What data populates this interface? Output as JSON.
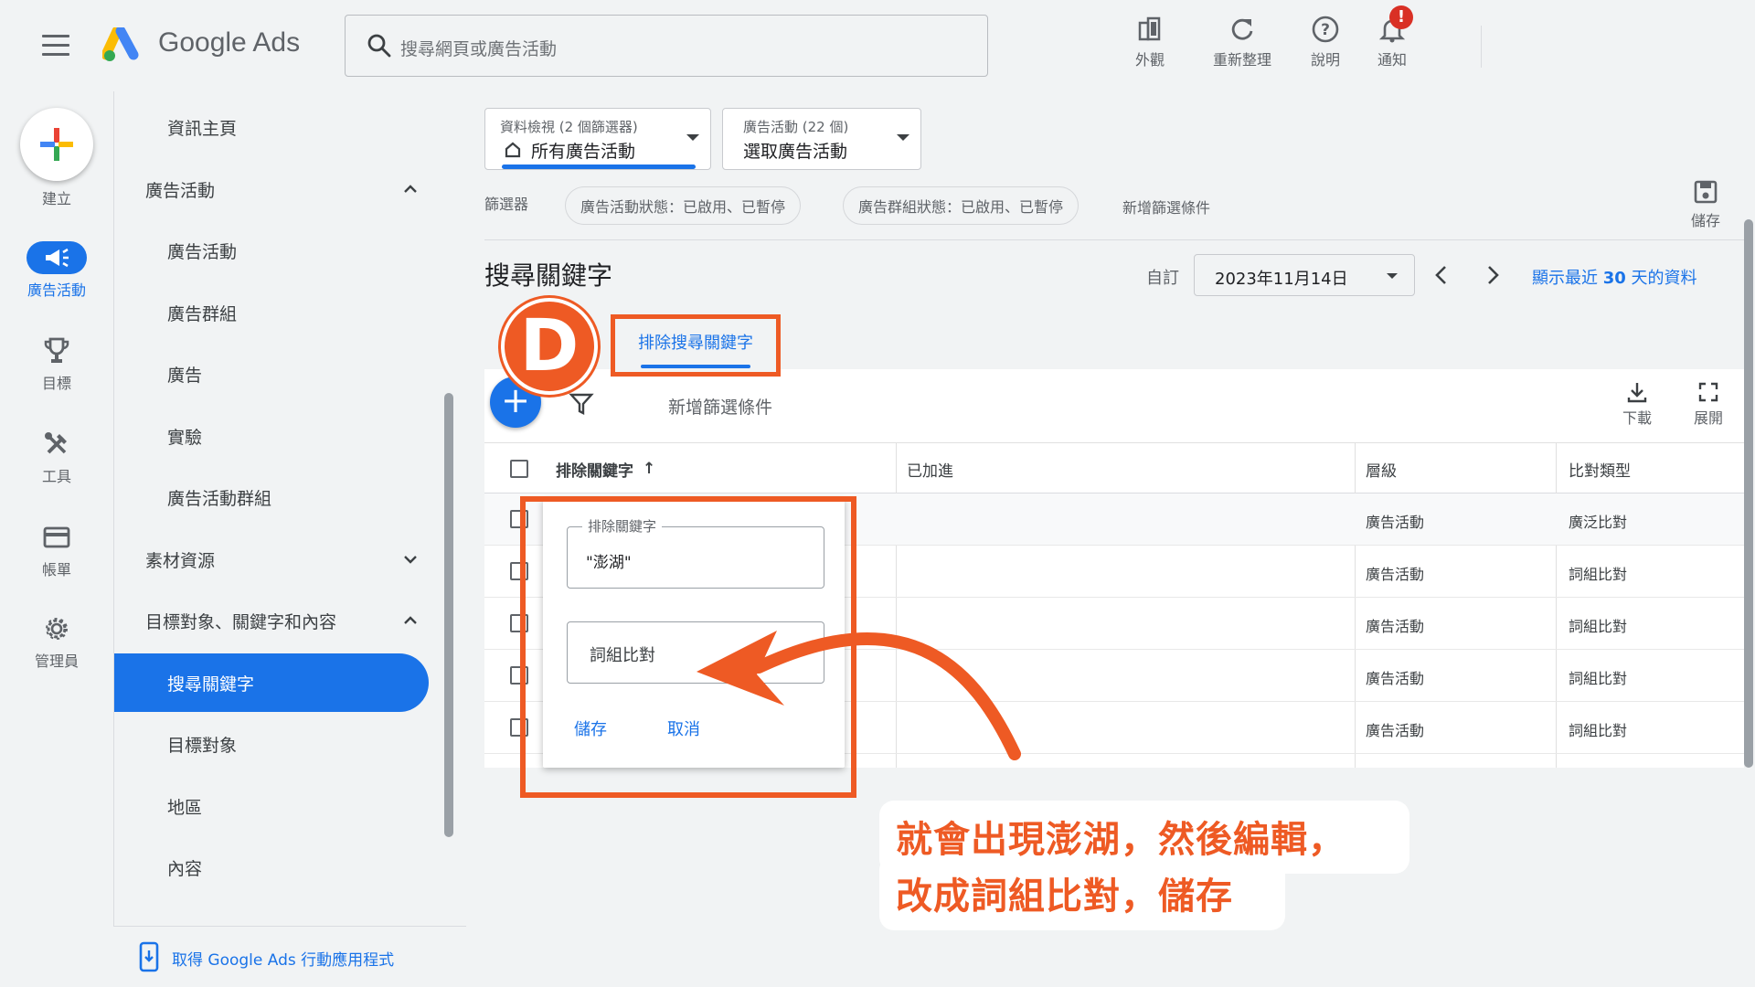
{
  "header": {
    "product_name": "Google Ads",
    "search_placeholder": "搜尋網頁或廣告活動",
    "actions": [
      {
        "label": "外觀",
        "icon": "appearance-icon"
      },
      {
        "label": "重新整理",
        "icon": "refresh-icon"
      },
      {
        "label": "說明",
        "icon": "help-icon"
      },
      {
        "label": "通知",
        "icon": "bell-icon"
      }
    ],
    "notification_badge": "!"
  },
  "rail": {
    "create_label": "建立",
    "items": [
      {
        "label": "廣告活動",
        "icon": "megaphone-icon",
        "active": true
      },
      {
        "label": "目標",
        "icon": "trophy-icon",
        "active": false
      },
      {
        "label": "工具",
        "icon": "tools-icon",
        "active": false
      },
      {
        "label": "帳單",
        "icon": "credit-card-icon",
        "active": false
      },
      {
        "label": "管理員",
        "icon": "gear-icon",
        "active": false
      }
    ]
  },
  "nav": {
    "items": [
      {
        "label": "資訊主頁",
        "type": "sub"
      },
      {
        "label": "廣告活動",
        "type": "section",
        "expanded": true
      },
      {
        "label": "廣告活動",
        "type": "sub"
      },
      {
        "label": "廣告群組",
        "type": "sub"
      },
      {
        "label": "廣告",
        "type": "sub"
      },
      {
        "label": "實驗",
        "type": "sub"
      },
      {
        "label": "廣告活動群組",
        "type": "sub"
      },
      {
        "label": "素材資源",
        "type": "section",
        "expanded": false
      },
      {
        "label": "目標對象、關鍵字和內容",
        "type": "section",
        "expanded": true
      },
      {
        "label": "搜尋關鍵字",
        "type": "sub",
        "active": true
      },
      {
        "label": "目標對象",
        "type": "sub"
      },
      {
        "label": "地區",
        "type": "sub"
      },
      {
        "label": "內容",
        "type": "sub"
      }
    ],
    "footer_link": "取得 Google Ads 行動應用程式"
  },
  "filters": {
    "view_small": "資料檢視 (2 個篩選器)",
    "view_big": "所有廣告活動",
    "campaign_small": "廣告活動 (22 個)",
    "campaign_big": "選取廣告活動",
    "label": "篩選器",
    "chips": [
      "廣告活動狀態：已啟用、已暫停",
      "廣告群組狀態：已啟用、已暫停"
    ],
    "add_filter": "新增篩選條件",
    "save_label": "儲存"
  },
  "page": {
    "title": "搜尋關鍵字",
    "date_label": "自訂",
    "date_value": "2023年11月14日",
    "recent_link_prefix": "顯示最近 ",
    "recent_link_num": "30",
    "recent_link_suffix": " 天的資料"
  },
  "tab": {
    "label": "排除搜尋關鍵字",
    "badge": "D"
  },
  "toolbar": {
    "add_filter": "新增篩選條件",
    "download": "下載",
    "expand": "展開"
  },
  "table": {
    "headers": [
      "排除關鍵字",
      "已加進",
      "層級",
      "比對類型"
    ],
    "sort_arrow": "↑",
    "rows": [
      {
        "level": "廣告活動",
        "match": "廣泛比對"
      },
      {
        "level": "廣告活動",
        "match": "詞組比對"
      },
      {
        "level": "廣告活動",
        "match": "詞組比對"
      },
      {
        "level": "廣告活動",
        "match": "詞組比對"
      },
      {
        "level": "廣告活動",
        "match": "詞組比對"
      }
    ]
  },
  "popover": {
    "field_label": "排除關鍵字",
    "field_value": "\"澎湖\"",
    "match_value": "詞組比對",
    "save": "儲存",
    "cancel": "取消"
  },
  "callout": {
    "line1": "就會出現澎湖，然後編輯，",
    "line2": "改成詞組比對，儲存"
  },
  "colors": {
    "accent": "#1a73e8",
    "annotation": "#ee5a24"
  }
}
